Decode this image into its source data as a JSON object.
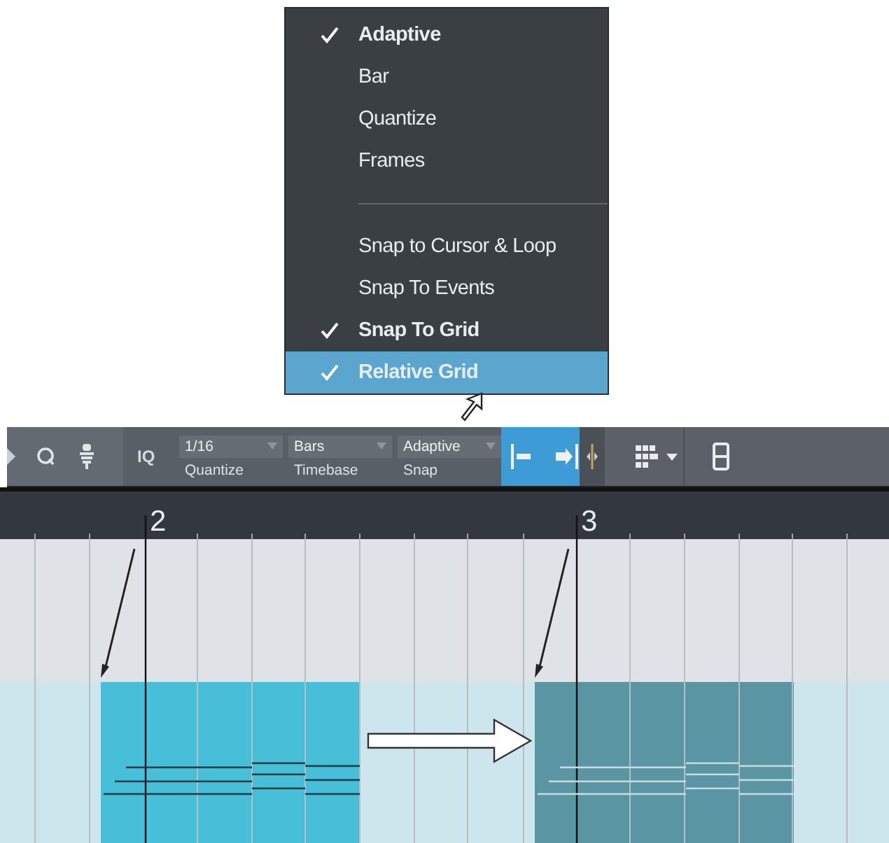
{
  "menu": {
    "items": [
      {
        "kind": "item",
        "label": "Adaptive",
        "checked": true,
        "selected": false
      },
      {
        "kind": "item",
        "label": "Bar",
        "checked": false,
        "selected": false
      },
      {
        "kind": "item",
        "label": "Quantize",
        "checked": false,
        "selected": false
      },
      {
        "kind": "item",
        "label": "Frames",
        "checked": false,
        "selected": false
      },
      {
        "kind": "separator"
      },
      {
        "kind": "item",
        "label": "Snap to Cursor & Loop",
        "checked": false,
        "selected": false
      },
      {
        "kind": "item",
        "label": "Snap To Events",
        "checked": false,
        "selected": false
      },
      {
        "kind": "item",
        "label": "Snap To Grid",
        "checked": true,
        "selected": false
      },
      {
        "kind": "item",
        "label": "Relative Grid",
        "checked": true,
        "selected": true
      }
    ]
  },
  "toolbar": {
    "iq_label": "IQ",
    "dropdowns": [
      {
        "value": "1/16",
        "label": "Quantize"
      },
      {
        "value": "Bars",
        "label": "Timebase"
      },
      {
        "value": "Adaptive",
        "label": "Snap"
      }
    ]
  },
  "ruler": {
    "marks": [
      "2",
      "3"
    ]
  },
  "events": [
    {
      "color": "#48bfd9"
    },
    {
      "color": "#5a95a3"
    }
  ]
}
